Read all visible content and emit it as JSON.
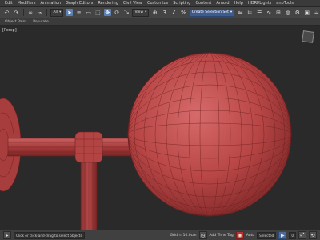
{
  "menu": {
    "items": [
      "Edit",
      "Modifiers",
      "Animation",
      "Graph Editors",
      "Rendering",
      "Civil View",
      "Customize",
      "Scripting",
      "Content",
      "Arnold",
      "Help",
      "HDRI/Lights",
      "anpTools"
    ]
  },
  "toolbar": {
    "filter_label": "All",
    "view_label": "View",
    "selection_set_label": "Create Selection Set",
    "reference_label": "3",
    "icons": [
      "undo-icon",
      "redo-icon",
      "link-icon",
      "unlink-icon",
      "bind-icon",
      "select-icon",
      "select-by-name-icon",
      "rect-select-icon",
      "window-crossing-icon",
      "move-icon",
      "rotate-icon",
      "scale-icon",
      "snap-icon",
      "angle-snap-icon",
      "percent-snap-icon",
      "mirror-icon",
      "align-icon",
      "layer-icon",
      "curve-editor-icon",
      "schematic-icon",
      "material-editor-icon",
      "render-setup-icon",
      "render-frame-icon",
      "render-icon"
    ]
  },
  "tabs": {
    "items": [
      "Object Paint",
      "Populate"
    ]
  },
  "viewport": {
    "label": "Persp",
    "model_color": "#b84a4a",
    "wire_color": "#7a2323"
  },
  "status": {
    "prompt": "Click or click-and-drag to select objects",
    "grid": "Grid = 10.0cm",
    "add_time_tag": "Add Time Tag",
    "frame": "0",
    "auto_label": "Auto",
    "selected_label": "Selected"
  }
}
